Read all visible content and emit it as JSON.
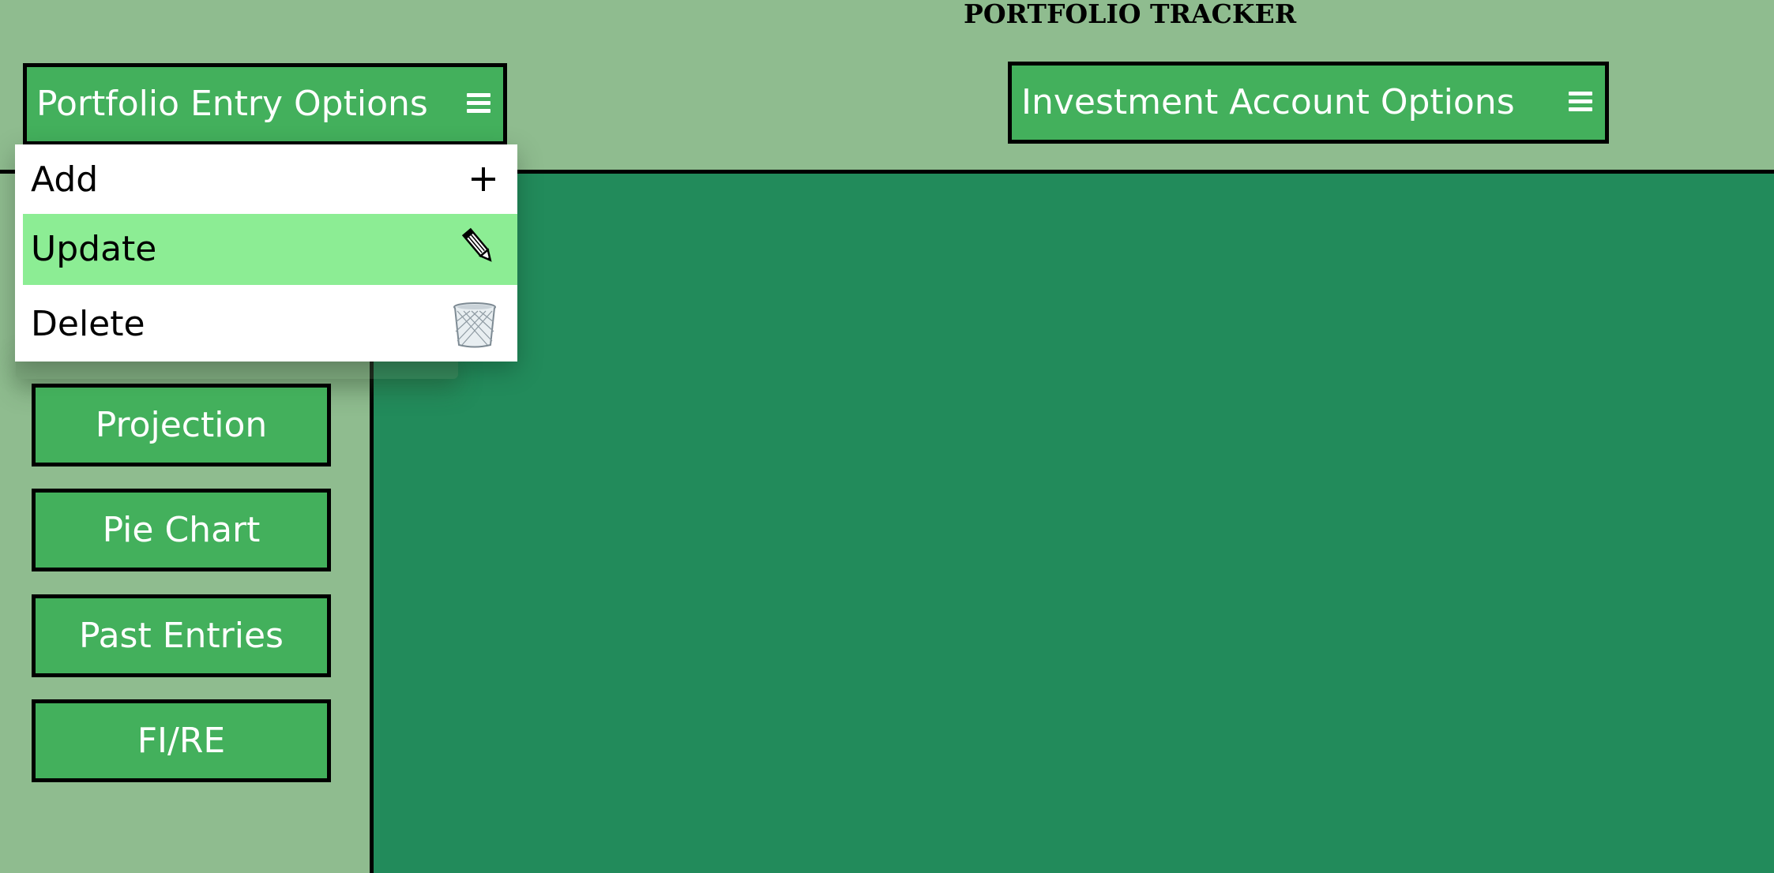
{
  "app": {
    "title": "PORTFOLIO TRACKER"
  },
  "header": {
    "entry_options_label": "Portfolio Entry Options",
    "account_options_label": "Investment Account Options",
    "menu_icon": "hamburger-menu-icon"
  },
  "dropdown": {
    "items": [
      {
        "label": "Add",
        "icon": "plus-icon"
      },
      {
        "label": "Update",
        "icon": "pencil-icon",
        "highlighted": true
      },
      {
        "label": "Delete",
        "icon": "trash-icon"
      }
    ]
  },
  "sidebar": {
    "items": [
      {
        "label": "Projection"
      },
      {
        "label": "Pie Chart"
      },
      {
        "label": "Past Entries"
      },
      {
        "label": "FI/RE"
      }
    ]
  },
  "colors": {
    "background": "#8fbc8f",
    "button": "#43b05c",
    "main_area": "#228b5b",
    "highlight": "#8ced94"
  }
}
